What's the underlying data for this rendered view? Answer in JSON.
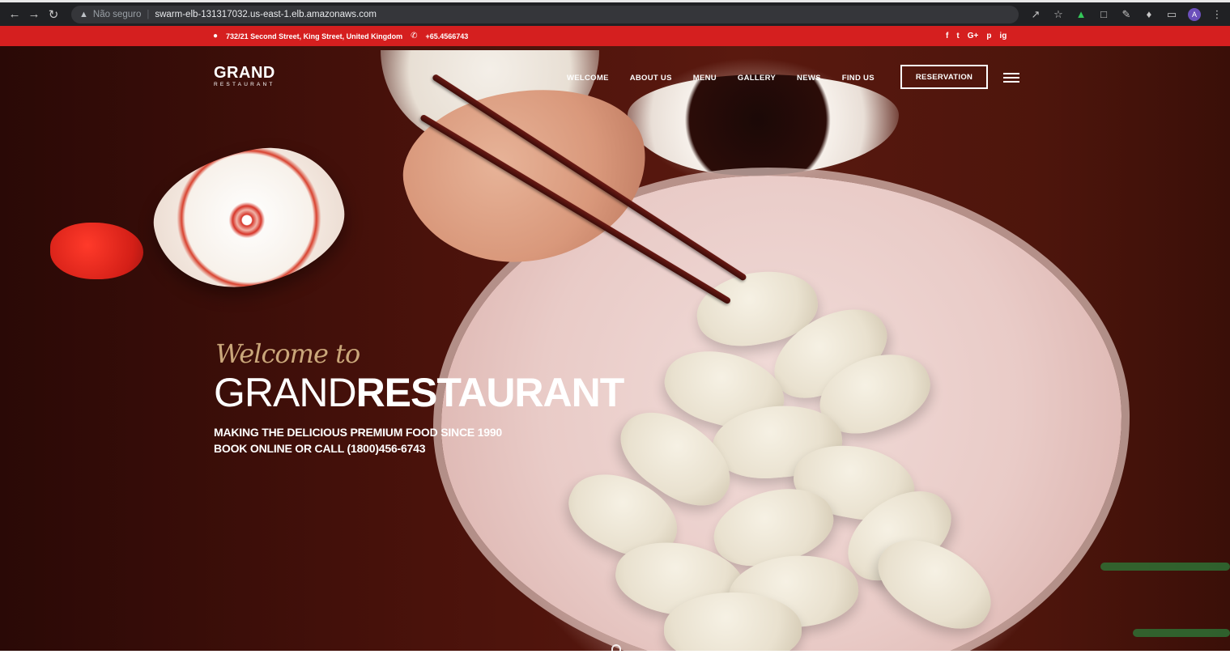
{
  "browser": {
    "security_label": "Não seguro",
    "url": "swarm-elb-131317032.us-east-1.elb.amazonaws.com",
    "profile_initial": "A"
  },
  "topbar": {
    "address": "732/21 Second Street, King Street, United Kingdom",
    "phone": "+65.4566743",
    "social": [
      "f",
      "t",
      "G+",
      "p",
      "ig"
    ]
  },
  "nav": {
    "logo_main": "GRAND",
    "logo_sub": "RESTAURANT",
    "items": [
      "WELCOME",
      "ABOUT US",
      "MENU",
      "GALLERY",
      "NEWS",
      "FIND US"
    ],
    "reservation_label": "RESERVATION"
  },
  "hero": {
    "welcome": "Welcome to",
    "title_thin": "GRAND",
    "title_bold": "RESTAURANT",
    "line1": "MAKING THE DELICIOUS PREMIUM FOOD SINCE 1990",
    "line2": "BOOK ONLINE OR CALL (1800)456-6743"
  },
  "colors": {
    "accent_red": "#d51f1f",
    "welcome_gold": "#caa77a"
  }
}
